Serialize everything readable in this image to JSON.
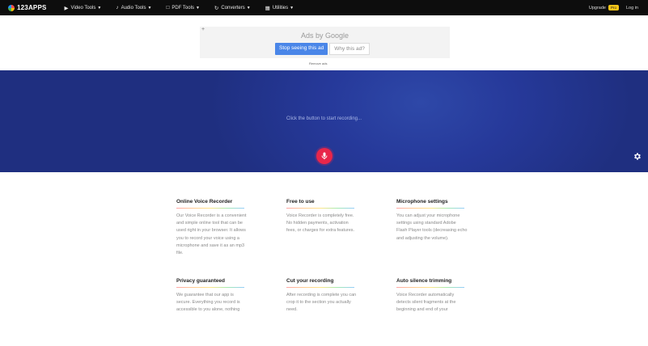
{
  "app": {
    "logo_text": "123APPS"
  },
  "nav": {
    "items": [
      {
        "label": "Video Tools",
        "icon": "play-icon"
      },
      {
        "label": "Audio Tools",
        "icon": "music-icon"
      },
      {
        "label": "PDF Tools",
        "icon": "pdf-icon"
      },
      {
        "label": "Converters",
        "icon": "converters-icon"
      },
      {
        "label": "Utilities",
        "icon": "grid-icon"
      }
    ],
    "upgrade_label": "Pro",
    "upgrade_text": "Upgrade",
    "login_label": "Log in"
  },
  "ad": {
    "title": "Ads by Google",
    "stop_label": "Stop seeing this ad",
    "why_label": "Why this ad?",
    "footer": "Remove ads"
  },
  "hero": {
    "prompt": "Click the button to start recording..."
  },
  "features": [
    {
      "title": "Online Voice Recorder",
      "text": "Our Voice Recorder is a convenient and simple online tool that can be used right in your browser. It allows you to record your voice using a microphone and save it as an mp3 file."
    },
    {
      "title": "Free to use",
      "text": "Voice Recorder is completely free. No hidden payments, activation fees, or charges for extra features."
    },
    {
      "title": "Microphone settings",
      "text": "You can adjust your microphone settings using standard Adobe Flash Player tools (decreasing echo and adjusting the volume)."
    },
    {
      "title": "Privacy guaranteed",
      "text": "We guarantee that our app is secure. Everything you record is accessible to you alone, nothing"
    },
    {
      "title": "Cut your recording",
      "text": "After recording is complete you can crop it to the section you actually need."
    },
    {
      "title": "Auto silence trimming",
      "text": "Voice Recorder automatically detects silent fragments at the beginning and end of your"
    }
  ],
  "colors": {
    "topbar": "#0d0d0d",
    "hero": "#26399a",
    "record": "#e8264a",
    "ad_button": "#4a86e8"
  }
}
